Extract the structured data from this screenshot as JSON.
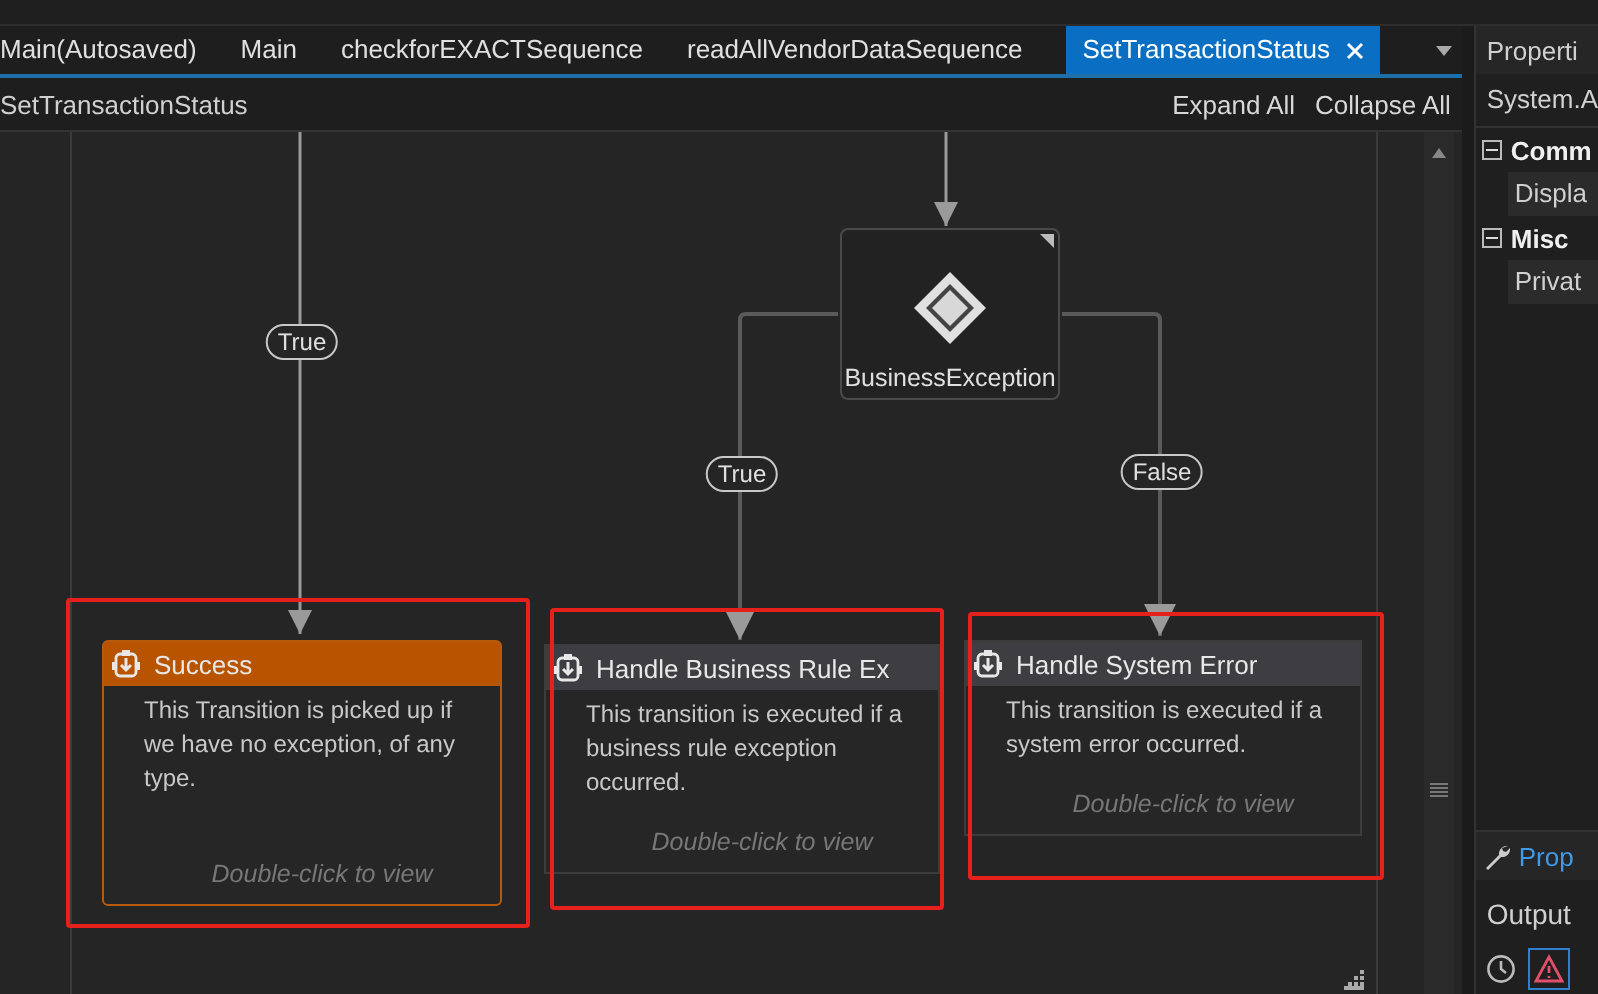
{
  "tabs": [
    {
      "label": "Main(Autosaved)",
      "selected": false,
      "closable": false
    },
    {
      "label": "Main",
      "selected": false,
      "closable": false
    },
    {
      "label": "checkforEXACTSequence",
      "selected": false,
      "closable": false
    },
    {
      "label": "readAllVendorDataSequence",
      "selected": false,
      "closable": false
    },
    {
      "label": "SetTransactionStatus",
      "selected": true,
      "closable": true
    }
  ],
  "breadcrumb": "SetTransactionStatus",
  "toolbar": [
    "Expand All",
    "Collapse All"
  ],
  "diagram": {
    "decision": {
      "label": "BusinessException"
    },
    "transition_labels": [
      "True",
      "True",
      "False"
    ],
    "cards": [
      {
        "title": "Success",
        "description": "This Transition is picked up if we have no exception, of any type.",
        "hint": "Double-click to view",
        "selected": true,
        "highlighted": true
      },
      {
        "title": "Handle Business Rule Ex",
        "description": "This transition is executed if a business rule exception occurred.",
        "hint": "Double-click to view",
        "selected": false,
        "highlighted": true
      },
      {
        "title": "Handle System Error",
        "description": "This transition is executed if a system error occurred.",
        "hint": "Double-click to view",
        "selected": false,
        "highlighted": true
      }
    ]
  },
  "properties": {
    "title": "Properti",
    "object": "System.A",
    "groups": [
      {
        "label": "Comm",
        "expanded": true,
        "rows": [
          "Displa"
        ]
      },
      {
        "label": "Misc",
        "expanded": true,
        "rows": [
          "Privat"
        ]
      }
    ],
    "tab": "Prop"
  },
  "output": {
    "title": "Output"
  }
}
